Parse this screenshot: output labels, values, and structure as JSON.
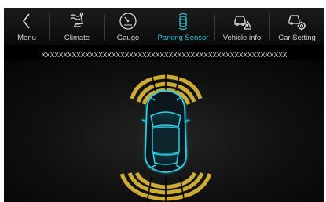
{
  "nav": {
    "items": [
      {
        "label": "Menu",
        "icon": "back-chevron-icon",
        "active": false
      },
      {
        "label": "Climate",
        "icon": "climate-seat-icon",
        "active": false
      },
      {
        "label": "Gauge",
        "icon": "gauge-icon",
        "active": false
      },
      {
        "label": "Parking Sensor",
        "icon": "parking-sensor-icon",
        "active": true
      },
      {
        "label": "Vehicle info",
        "icon": "vehicle-info-icon",
        "active": false
      },
      {
        "label": "Car Setting",
        "icon": "car-setting-icon",
        "active": false
      }
    ]
  },
  "status_text": "XXXXXXXXXXXXXXXXXXXXXXXXXXXXXXXXXXXXXXXXXXXXXXXXXXXXXXXX",
  "parking": {
    "front_sensor_segments": 4,
    "rear_sensor_segments": 4,
    "sensor_color": "#d9b43a",
    "car_outline_color": "#2fd2e6"
  },
  "colors": {
    "accent": "#31c2d6",
    "background": "#000000"
  }
}
